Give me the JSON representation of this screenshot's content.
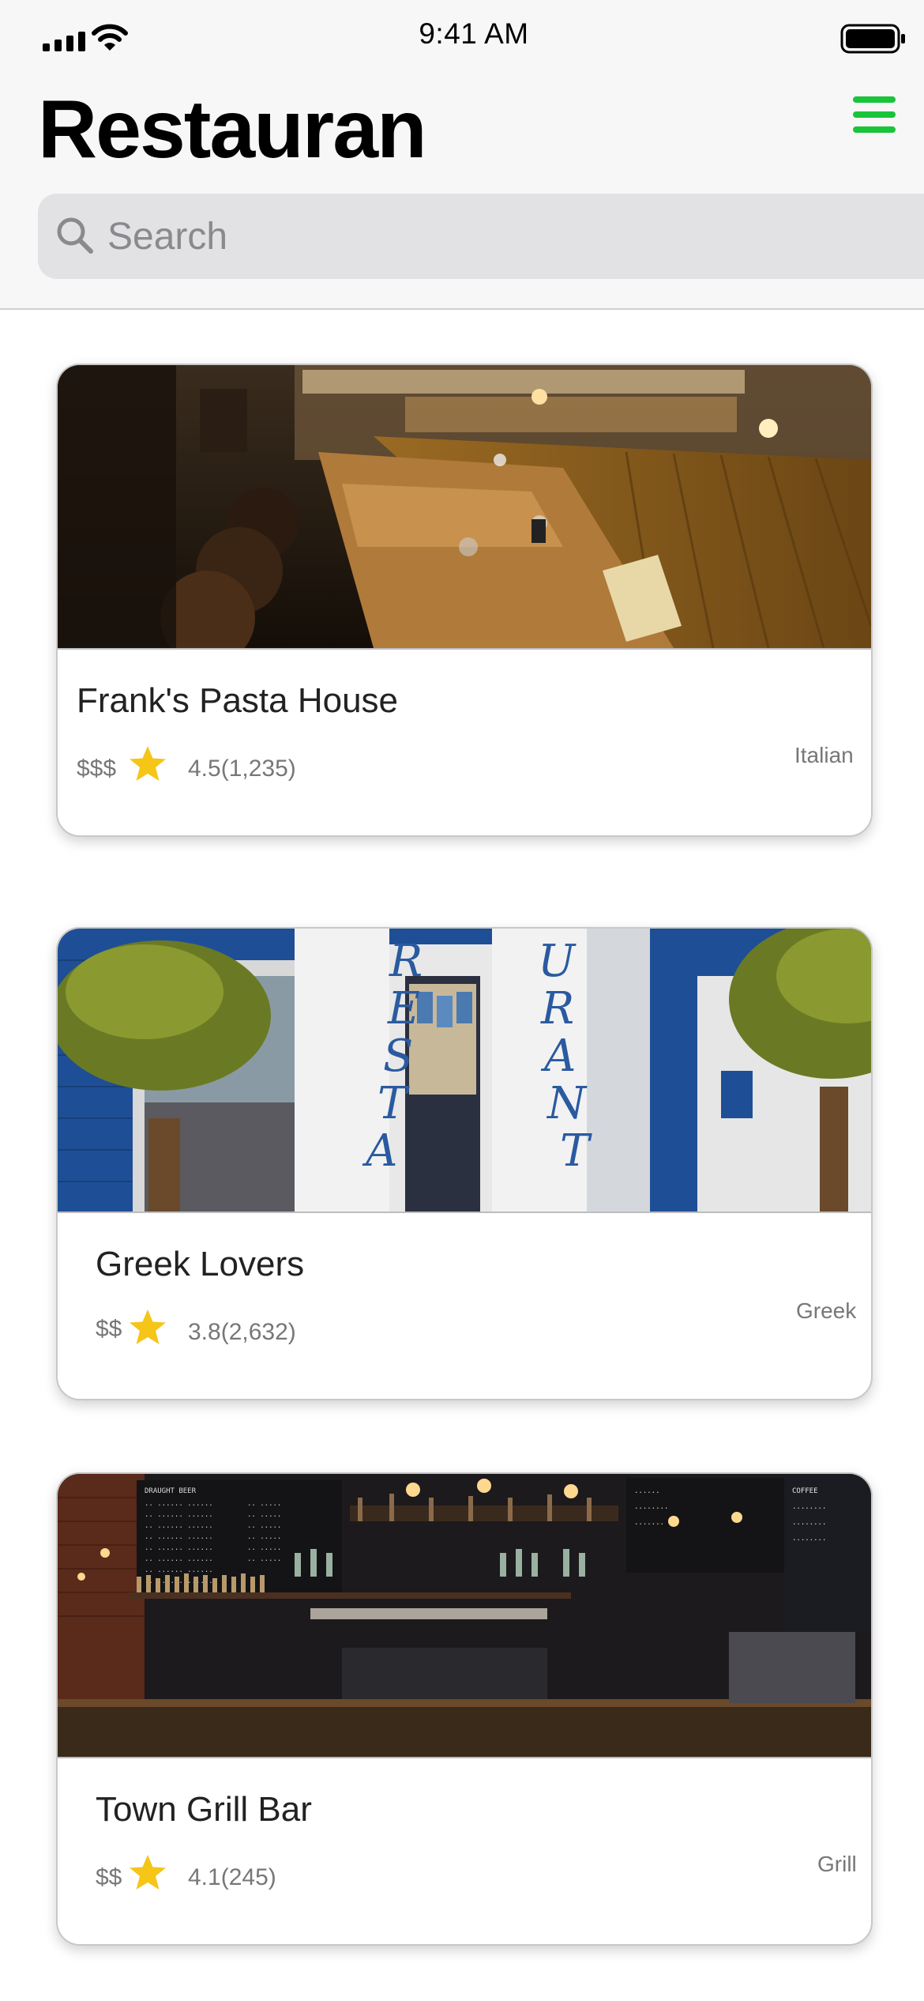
{
  "status_bar": {
    "time": "9:41 AM"
  },
  "header": {
    "title": "Restauran",
    "menu_icon": "hamburger-menu-icon",
    "accent_color": "#19c43a"
  },
  "search": {
    "placeholder": "Search",
    "value": ""
  },
  "restaurants": [
    {
      "name": "Frank's Pasta House",
      "price": "$$$",
      "rating": "4.5(1,235)",
      "cuisine": "Italian"
    },
    {
      "name": "Greek Lovers",
      "price": "$$",
      "rating": "3.8(2,632)",
      "cuisine": "Greek"
    },
    {
      "name": "Town Grill Bar",
      "price": "$$",
      "rating": "4.1(245)",
      "cuisine": "Grill"
    }
  ],
  "star_color": "#f5c518"
}
